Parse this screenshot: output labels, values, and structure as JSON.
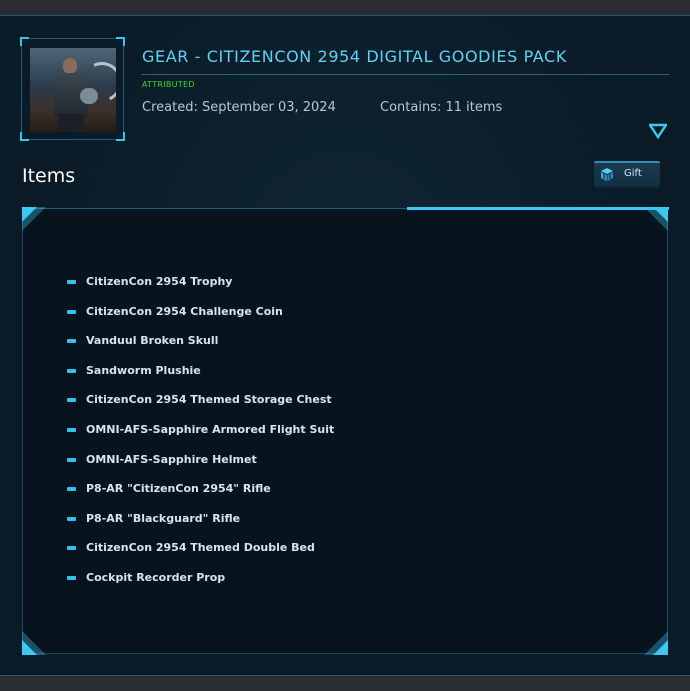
{
  "pledge": {
    "title": "GEAR - CITIZENCON 2954 DIGITAL GOODIES PACK",
    "status": "ATTRIBUTED",
    "created": "Created: September 03, 2024",
    "contains": "Contains: 11 items",
    "thumbnail": "pledge-thumbnail"
  },
  "items_section": {
    "heading": "Items",
    "gift_label": "Gift",
    "gift_icon": "gift-box-icon"
  },
  "items": [
    "CitizenCon 2954 Trophy",
    "CitizenCon 2954 Challenge Coin",
    "Vanduul Broken Skull",
    "Sandworm Plushie",
    "CitizenCon 2954 Themed Storage Chest",
    "OMNI-AFS-Sapphire Armored Flight Suit",
    "OMNI-AFS-Sapphire Helmet",
    "P8-AR \"CitizenCon 2954\" Rifle",
    "P8-AR \"Blackguard\" Rifle",
    "CitizenCon 2954 Themed Double Bed",
    "Cockpit Recorder Prop"
  ],
  "colors": {
    "accent": "#3cc8f0",
    "title": "#5fd3f5",
    "attributed": "#2edb2e",
    "background": "#0a1a26"
  }
}
